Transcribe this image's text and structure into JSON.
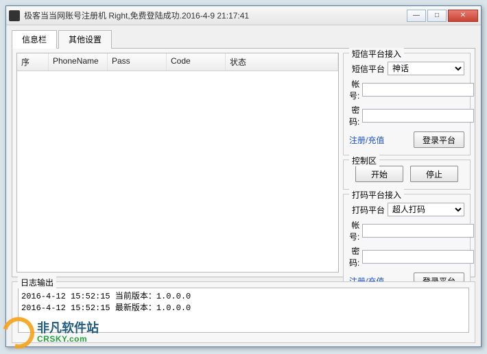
{
  "window": {
    "title": "极客当当网账号注册机     Right,免费登陆成功.2016-4-9 21:17:41"
  },
  "tabs": {
    "info": "信息栏",
    "other": "其他设置"
  },
  "table": {
    "headers": {
      "seq": "序",
      "phone": "PhoneName",
      "pass": "Pass",
      "code": "Code",
      "status": "状态"
    }
  },
  "sms": {
    "legend": "短信平台接入",
    "platformLabel": "短信平台",
    "platformValue": "神话",
    "accountLabel": "帐号:",
    "passwordLabel": "密码:",
    "registerLink": "注册/充值",
    "loginBtn": "登录平台"
  },
  "control": {
    "legend": "控制区",
    "start": "开始",
    "stop": "停止"
  },
  "captcha": {
    "legend": "打码平台接入",
    "platformLabel": "打码平台",
    "platformValue": "超人打码",
    "accountLabel": "帐号:",
    "passwordLabel": "密码:",
    "registerLink": "注册/充值",
    "loginBtn": "登录平台"
  },
  "log": {
    "legend": "日志输出",
    "content": "2016-4-12 15:52:15 当前版本：1.0.0.0\n2016-4-12 15:52:15 最新版本：1.0.0.0"
  },
  "watermark": {
    "cn": "非凡软件站",
    "en": "CRSKY.com"
  }
}
